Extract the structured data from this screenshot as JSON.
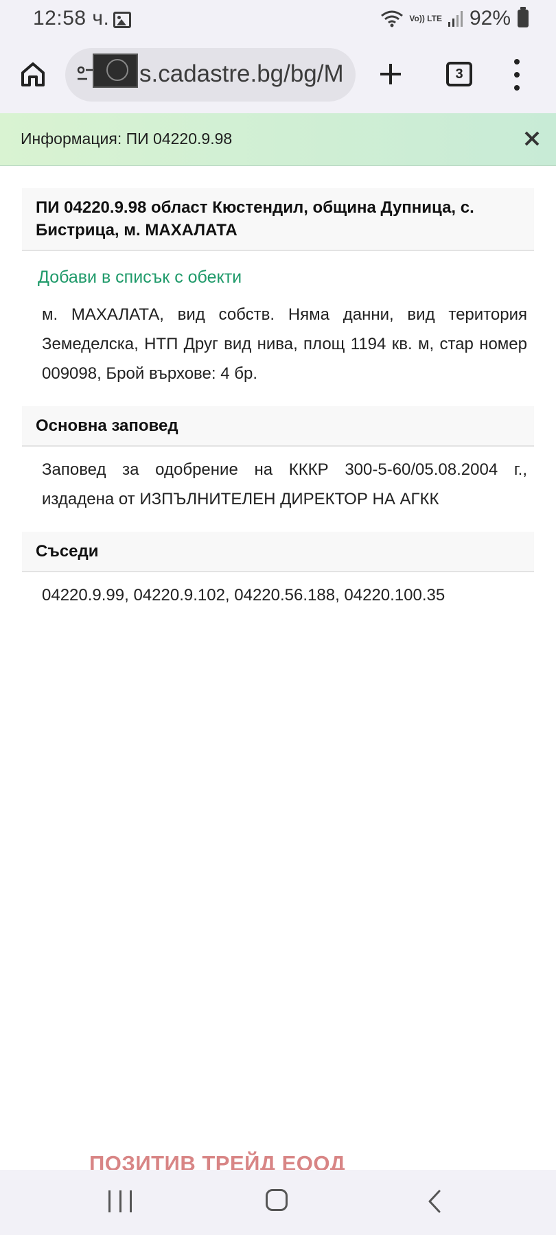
{
  "status_bar": {
    "time": "12:58 ч.",
    "network_label": "Vo)) LTE",
    "battery": "92%"
  },
  "browser": {
    "url": "s.cadastre.bg/bg/M",
    "tab_count": "3"
  },
  "info_banner": {
    "text": "Информация: ПИ 04220.9.98"
  },
  "property": {
    "title": "ПИ 04220.9.98 област Кюстендил, община Дупница, с. Бистрица, м. МАХАЛАТА",
    "add_link": "Добави в списък с обекти",
    "description": "м. МАХАЛАТА, вид собств. Няма данни, вид територия Земеделска, НТП Друг вид нива, площ 1194 кв. м, стар номер 009098, Брой върхове: 4 бр."
  },
  "order_section": {
    "header": "Основна заповед",
    "body": "Заповед за одобрение на КККР 300-5-60/05.08.2004 г., издадена от ИЗПЪЛНИТЕЛЕН ДИРЕКТОР НА АГКК"
  },
  "neighbors_section": {
    "header": "Съседи",
    "body": "04220.9.99, 04220.9.102, 04220.56.188, 04220.100.35"
  },
  "watermark": "ПОЗИТИВ ТРЕЙД ЕООД"
}
